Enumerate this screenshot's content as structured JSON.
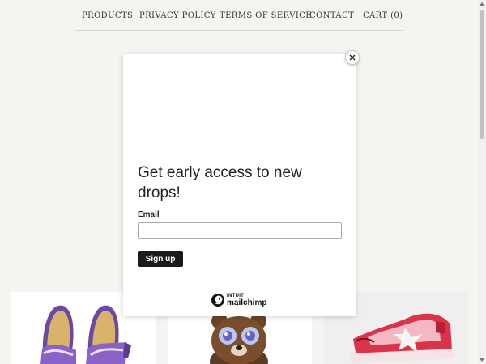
{
  "nav": {
    "items": [
      "PRODUCTS",
      "PRIVACY POLICY",
      "TERMS OF SERVICE",
      "CONTACT",
      "CART (0)"
    ]
  },
  "modal": {
    "title": "Get early access to new drops!",
    "email_label": "Email",
    "email_value": "",
    "signup_label": "Sign up",
    "close_icon": "close-icon",
    "logo": {
      "top": "INTUIT",
      "name": "mailchimp"
    }
  },
  "products": [
    {
      "image": "sandals-image"
    },
    {
      "image": "bear-figure-image"
    },
    {
      "image": "sneaker-image"
    }
  ],
  "colors": {
    "page_background": "#f5f4f0",
    "button_background": "#1a1a1a",
    "sneaker_red": "#c8283a"
  }
}
